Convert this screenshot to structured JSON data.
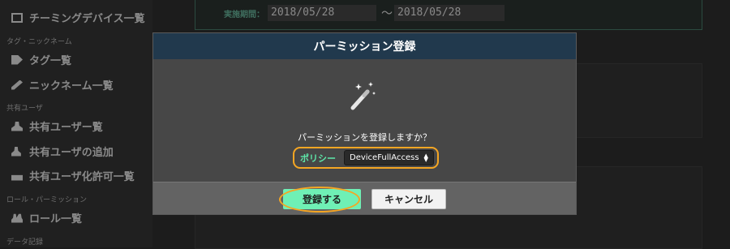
{
  "sidebar": {
    "items": [
      {
        "label": "チーミングデバイス一覧",
        "icon": "square-icon"
      },
      {
        "label": "タグ一覧",
        "icon": "tag-icon"
      },
      {
        "label": "ニックネーム一覧",
        "icon": "pencil-icon"
      },
      {
        "label": "共有ユーザー覧",
        "icon": "user-icon"
      },
      {
        "label": "共有ユーザの追加",
        "icon": "user-add-icon"
      },
      {
        "label": "共有ユーザ化許可一覧",
        "icon": "lock-icon"
      },
      {
        "label": "ロール一覧",
        "icon": "users-icon"
      }
    ],
    "sections": [
      "タグ・ニックネーム",
      "共有ユーザ",
      "ロール・パーミッション",
      "データ記録"
    ]
  },
  "date_filter": {
    "label": "実施期間：",
    "from": "2018/05/28",
    "separator": "〜",
    "to": "2018/05/28"
  },
  "modal": {
    "title": "パーミッション登録",
    "icon": "magic-wand-icon",
    "question": "パーミッションを登録しますか？",
    "policy_label": "ポリシー",
    "policy_value": "DeviceFullAccess",
    "register_label": "登録する",
    "cancel_label": "キャンセル"
  },
  "colors": {
    "header": "#21394d",
    "accent_green": "#6ff0b5",
    "highlight_orange": "#f5a623"
  }
}
